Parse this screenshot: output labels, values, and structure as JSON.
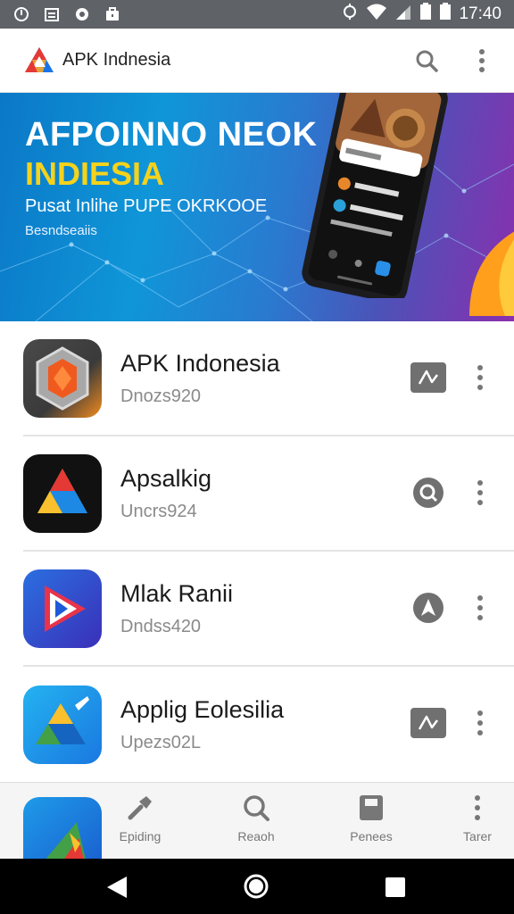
{
  "status_bar": {
    "time": "17:40"
  },
  "app_bar": {
    "title": "APK Indnesia"
  },
  "banner": {
    "headline": "AFPOINNO NEOK",
    "headline2": "INDIESIA",
    "subtitle": "Pusat Inlihe PUPE OKRKOOE",
    "small": "Besndseaiis"
  },
  "apps": [
    {
      "name": "APK Indonesia",
      "sub": "Dnozs920",
      "action_icon": "chart-icon"
    },
    {
      "name": "Apsalkig",
      "sub": "Uncrs924",
      "action_icon": "search-badge-icon"
    },
    {
      "name": "Mlak Ranii",
      "sub": "Dndss420",
      "action_icon": "navigation-icon"
    },
    {
      "name": "Applig Eolesilia",
      "sub": "Upezs02L",
      "action_icon": "chart-icon"
    }
  ],
  "bottom_nav": {
    "items": [
      {
        "label": "Epiding",
        "icon": "wrench-icon"
      },
      {
        "label": "Reaoh",
        "icon": "search-icon"
      },
      {
        "label": "Penees",
        "icon": "folder-icon"
      },
      {
        "label": "Tarer",
        "icon": "more-vertical-icon"
      }
    ]
  }
}
